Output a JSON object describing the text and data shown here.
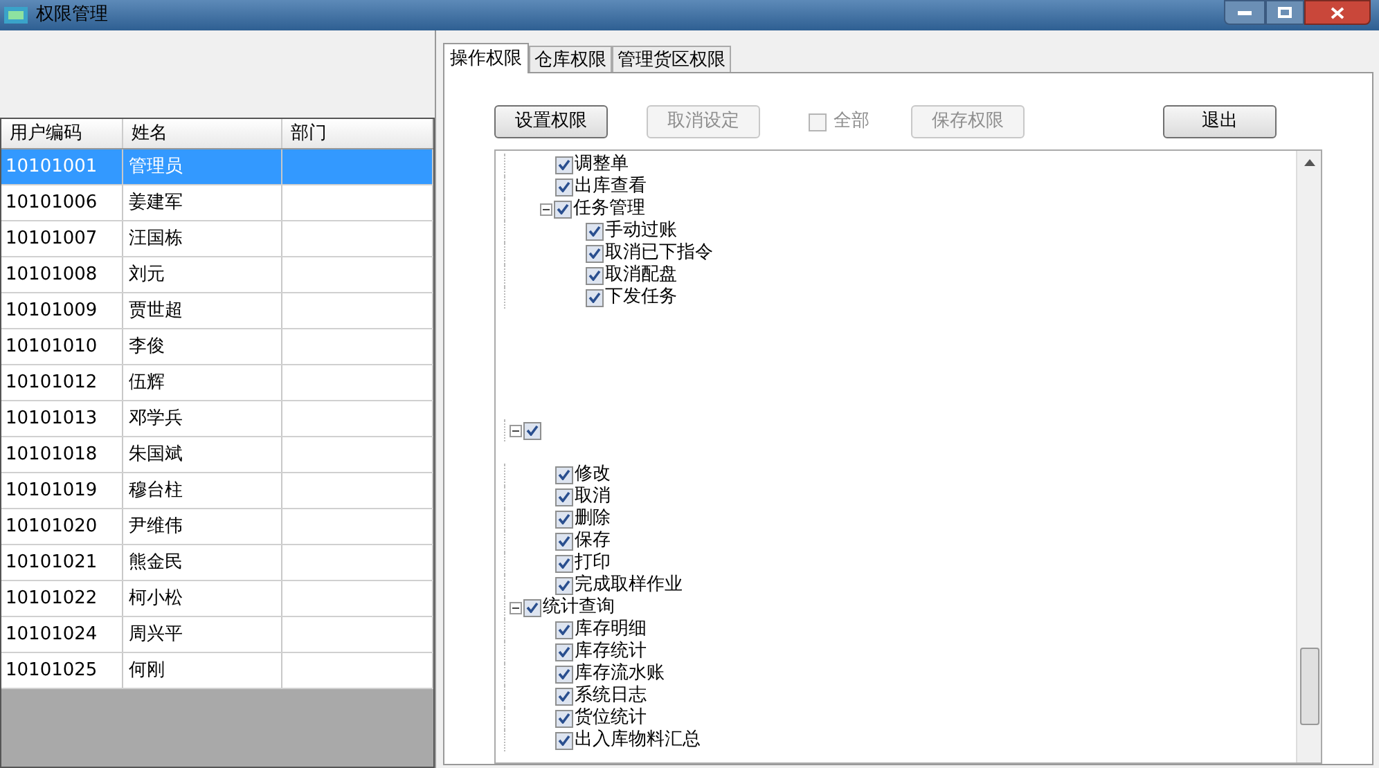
{
  "window": {
    "title": "权限管理"
  },
  "users": {
    "columns": [
      "用户编码",
      "姓名",
      "部门"
    ],
    "rows": [
      {
        "code": "10101001",
        "name": "管理员",
        "selected": true
      },
      {
        "code": "10101006",
        "name": "姜建军",
        "selected": false
      },
      {
        "code": "10101007",
        "name": "汪国栋",
        "selected": false
      },
      {
        "code": "10101008",
        "name": "刘元",
        "selected": false
      },
      {
        "code": "10101009",
        "name": "贾世超",
        "selected": false
      },
      {
        "code": "10101010",
        "name": "李俊",
        "selected": false
      },
      {
        "code": "10101012",
        "name": "伍辉",
        "selected": false
      },
      {
        "code": "10101013",
        "name": "邓学兵",
        "selected": false
      },
      {
        "code": "10101018",
        "name": "朱国斌",
        "selected": false
      },
      {
        "code": "10101019",
        "name": "穆台柱",
        "selected": false
      },
      {
        "code": "10101020",
        "name": "尹维伟",
        "selected": false
      },
      {
        "code": "10101021",
        "name": "熊金民",
        "selected": false
      },
      {
        "code": "10101022",
        "name": "柯小松",
        "selected": false
      },
      {
        "code": "10101024",
        "name": "周兴平",
        "selected": false
      },
      {
        "code": "10101025",
        "name": "何刚",
        "selected": false
      }
    ]
  },
  "tabs": [
    {
      "label": "操作权限",
      "selected": true
    },
    {
      "label": "仓库权限",
      "selected": false
    },
    {
      "label": "管理货区权限",
      "selected": false
    }
  ],
  "toolbar": [
    {
      "kind": "button",
      "label": "设置权限",
      "disabled": false
    },
    {
      "kind": "button",
      "label": "取消设定",
      "disabled": true
    },
    {
      "kind": "checkbox",
      "label": "全部",
      "checked": false,
      "disabled": true
    },
    {
      "kind": "button",
      "label": "保存权限",
      "disabled": true
    },
    {
      "kind": "button",
      "label": "退出",
      "disabled": false
    }
  ],
  "tree": [
    {
      "children": [
        {
          "label": "调整单",
          "checked": true
        },
        {
          "label": "出库查看",
          "checked": true
        },
        {
          "label": "任务管理",
          "checked": true,
          "expanded": true,
          "children": [
            {
              "label": "手动过账",
              "checked": true
            },
            {
              "label": "取消已下指令",
              "checked": true
            },
            {
              "label": "取消配盘",
              "checked": true
            },
            {
              "label": "下发任务",
              "checked": true
            }
          ]
        }
      ]
    },
    {
      "checked": true,
      "expanded": true,
      "children": [
        {
          "label": "修改",
          "checked": true
        },
        {
          "label": "取消",
          "checked": true
        },
        {
          "label": "删除",
          "checked": true
        },
        {
          "label": "保存",
          "checked": true
        },
        {
          "label": "打印",
          "checked": true
        },
        {
          "label": "完成取样作业",
          "checked": true
        }
      ]
    },
    {
      "label": "统计查询",
      "checked": true,
      "expanded": true,
      "children": [
        {
          "label": "库存明细",
          "checked": true
        },
        {
          "label": "库存统计",
          "checked": true
        },
        {
          "label": "库存流水账",
          "checked": true
        },
        {
          "label": "系统日志",
          "checked": true
        },
        {
          "label": "货位统计",
          "checked": true
        },
        {
          "label": "出入库物料汇总",
          "checked": true
        }
      ]
    }
  ]
}
